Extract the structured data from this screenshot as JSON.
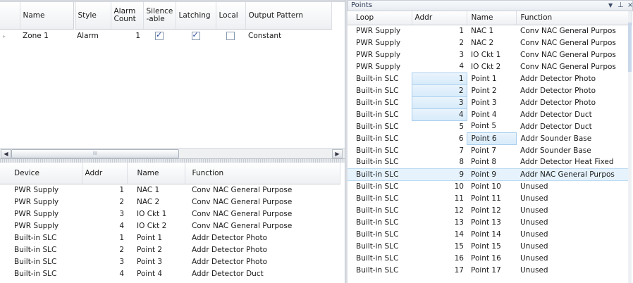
{
  "zones": {
    "columns": [
      "Name",
      "Style",
      "Alarm\nCount",
      "Silence\n-able",
      "Latching",
      "Local",
      "Output Pattern"
    ],
    "rows": [
      {
        "name": "Zone 1",
        "style": "Alarm",
        "alarm_count": "1",
        "silenceable": true,
        "latching": true,
        "local": false,
        "output_pattern": "Constant"
      }
    ]
  },
  "scrollbar": {
    "grip": "III"
  },
  "devices": {
    "columns": [
      "Device",
      "Addr",
      "Name",
      "Function"
    ],
    "rows": [
      {
        "device": "PWR Supply",
        "addr": "1",
        "name": "NAC 1",
        "function": "Conv NAC General Purpose"
      },
      {
        "device": "PWR Supply",
        "addr": "2",
        "name": "NAC 2",
        "function": "Conv NAC General Purpose"
      },
      {
        "device": "PWR Supply",
        "addr": "3",
        "name": "IO Ckt 1",
        "function": "Conv NAC General Purpose"
      },
      {
        "device": "PWR Supply",
        "addr": "4",
        "name": "IO Ckt 2",
        "function": "Conv NAC General Purpose"
      },
      {
        "device": "Built-in SLC",
        "addr": "1",
        "name": "Point 1",
        "function": "Addr Detector Photo"
      },
      {
        "device": "Built-in SLC",
        "addr": "2",
        "name": "Point 2",
        "function": "Addr Detector Photo"
      },
      {
        "device": "Built-in SLC",
        "addr": "3",
        "name": "Point 3",
        "function": "Addr Detector Photo"
      },
      {
        "device": "Built-in SLC",
        "addr": "4",
        "name": "Point 4",
        "function": "Addr Detector Duct"
      }
    ]
  },
  "points": {
    "title": "Points",
    "pin_icon": "pin-icon",
    "dropdown_icon": "chevron-down-icon",
    "columns": [
      "Loop",
      "Addr",
      "Name",
      "Function"
    ],
    "rows": [
      {
        "loop": "PWR Supply",
        "addr": "1",
        "name": "NAC 1",
        "function": "Conv NAC General Purpos"
      },
      {
        "loop": "PWR Supply",
        "addr": "2",
        "name": "NAC 2",
        "function": "Conv NAC General Purpos"
      },
      {
        "loop": "PWR Supply",
        "addr": "3",
        "name": "IO Ckt 1",
        "function": "Conv NAC General Purpos"
      },
      {
        "loop": "PWR Supply",
        "addr": "4",
        "name": "IO Ckt 2",
        "function": "Conv NAC General Purpos"
      },
      {
        "loop": "Built-in SLC",
        "addr": "1",
        "name": "Point 1",
        "function": "Addr Detector Photo"
      },
      {
        "loop": "Built-in SLC",
        "addr": "2",
        "name": "Point 2",
        "function": "Addr Detector Photo"
      },
      {
        "loop": "Built-in SLC",
        "addr": "3",
        "name": "Point 3",
        "function": "Addr Detector Photo"
      },
      {
        "loop": "Built-in SLC",
        "addr": "4",
        "name": "Point 4",
        "function": "Addr Detector Duct"
      },
      {
        "loop": "Built-in SLC",
        "addr": "5",
        "name": "Point 5",
        "function": "Addr Detector Duct"
      },
      {
        "loop": "Built-in SLC",
        "addr": "6",
        "name": "Point 6",
        "function": "Addr Sounder Base"
      },
      {
        "loop": "Built-in SLC",
        "addr": "7",
        "name": "Point 7",
        "function": "Addr Sounder Base"
      },
      {
        "loop": "Built-in SLC",
        "addr": "8",
        "name": "Point 8",
        "function": "Addr Detector Heat Fixed"
      },
      {
        "loop": "Built-in SLC",
        "addr": "9",
        "name": "Point 9",
        "function": "Addr NAC General Purpos"
      },
      {
        "loop": "Built-in SLC",
        "addr": "10",
        "name": "Point 10",
        "function": "Unused"
      },
      {
        "loop": "Built-in SLC",
        "addr": "11",
        "name": "Point 11",
        "function": "Unused"
      },
      {
        "loop": "Built-in SLC",
        "addr": "12",
        "name": "Point 12",
        "function": "Unused"
      },
      {
        "loop": "Built-in SLC",
        "addr": "13",
        "name": "Point 13",
        "function": "Unused"
      },
      {
        "loop": "Built-in SLC",
        "addr": "14",
        "name": "Point 14",
        "function": "Unused"
      },
      {
        "loop": "Built-in SLC",
        "addr": "15",
        "name": "Point 15",
        "function": "Unused"
      },
      {
        "loop": "Built-in SLC",
        "addr": "16",
        "name": "Point 16",
        "function": "Unused"
      },
      {
        "loop": "Built-in SLC",
        "addr": "17",
        "name": "Point 17",
        "function": "Unused"
      }
    ]
  },
  "colors": {
    "selection": "#d7ebfa",
    "header_bg": "#eef0f3",
    "border": "#c8ced6"
  }
}
